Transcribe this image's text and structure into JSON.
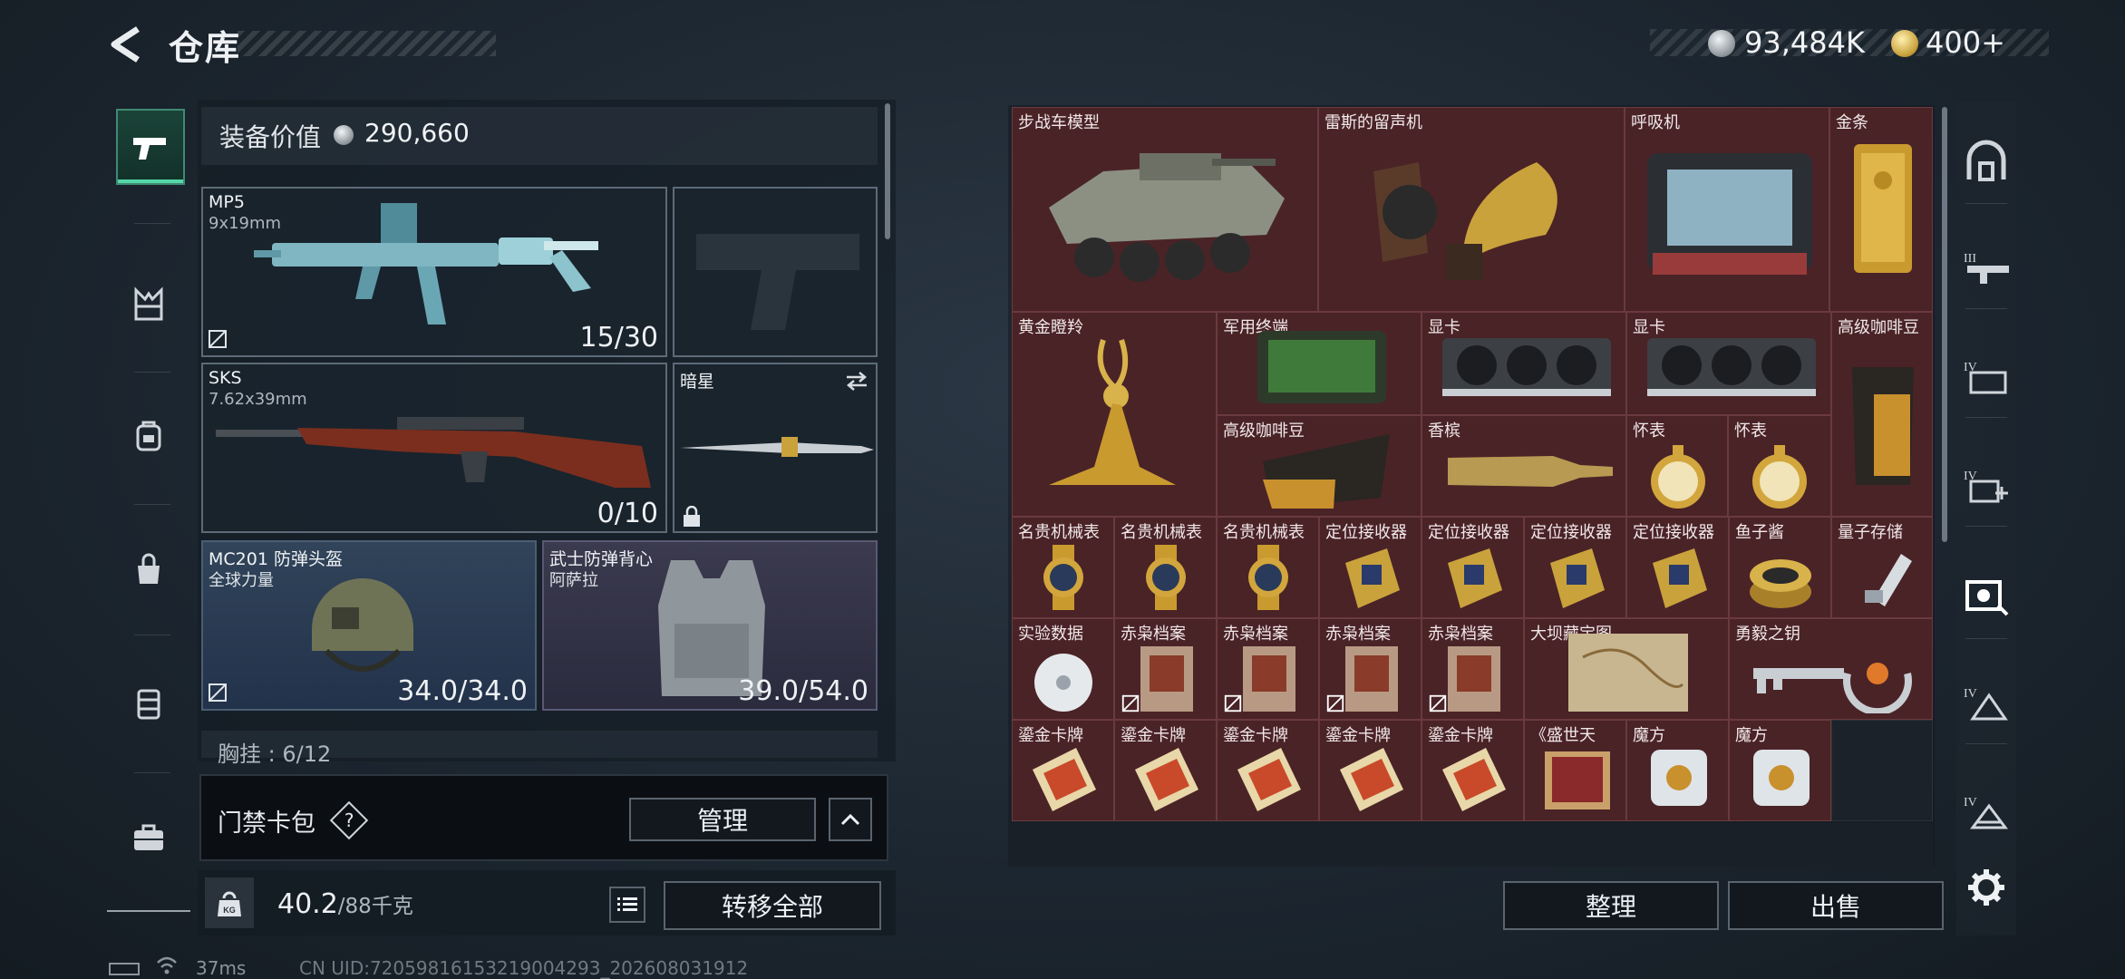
{
  "header": {
    "title": "仓库",
    "currency1": "93,484K",
    "currency2": "400+"
  },
  "loadout": {
    "equipment_value_label": "装备价值",
    "equipment_value": "290,660",
    "primary": {
      "name": "MP5",
      "ammo_type": "9x19mm",
      "ammo": "15/30"
    },
    "secondary": {
      "name": "SKS",
      "ammo_type": "7.62x39mm",
      "ammo": "0/10"
    },
    "melee": {
      "name": "暗星"
    },
    "helmet": {
      "name": "MC201 防弹头盔",
      "brand": "全球力量",
      "durability": "34.0/34.0"
    },
    "armor": {
      "name": "武士防弹背心",
      "brand": "阿萨拉",
      "durability": "39.0/54.0"
    },
    "chest_rig_partial": "胸挂 : 6/12"
  },
  "card_bag": {
    "label": "门禁卡包",
    "help": "?",
    "manage_label": "管理"
  },
  "weight": {
    "current": "40.2",
    "max": "/88千克",
    "kg_icon_label": "KG"
  },
  "transfer_all_label": "转移全部",
  "storage": {
    "items": [
      {
        "label": "步战车模型"
      },
      {
        "label": "雷斯的留声机"
      },
      {
        "label": "呼吸机"
      },
      {
        "label": "金条"
      },
      {
        "label": "黄金瞪羚"
      },
      {
        "label": "军用终端"
      },
      {
        "label": "显卡"
      },
      {
        "label": "显卡"
      },
      {
        "label": "高级咖啡豆"
      },
      {
        "label": "高级咖啡豆"
      },
      {
        "label": "香槟"
      },
      {
        "label": "怀表"
      },
      {
        "label": "怀表"
      },
      {
        "label": "名贵机械表"
      },
      {
        "label": "名贵机械表"
      },
      {
        "label": "名贵机械表"
      },
      {
        "label": "定位接收器"
      },
      {
        "label": "定位接收器"
      },
      {
        "label": "定位接收器"
      },
      {
        "label": "定位接收器"
      },
      {
        "label": "鱼子酱"
      },
      {
        "label": "量子存储"
      },
      {
        "label": "实验数据"
      },
      {
        "label": "赤枭档案"
      },
      {
        "label": "赤枭档案"
      },
      {
        "label": "赤枭档案"
      },
      {
        "label": "赤枭档案"
      },
      {
        "label": "大坝藏宝图"
      },
      {
        "label": "勇毅之钥"
      },
      {
        "label": "鎏金卡牌"
      },
      {
        "label": "鎏金卡牌"
      },
      {
        "label": "鎏金卡牌"
      },
      {
        "label": "鎏金卡牌"
      },
      {
        "label": "鎏金卡牌"
      },
      {
        "label": "《盛世天"
      },
      {
        "label": "魔方"
      },
      {
        "label": "魔方"
      }
    ],
    "sort_label": "整理",
    "sell_label": "出售"
  },
  "status": {
    "ping": "37ms",
    "uid": "CN UID:720598161532190042​93_202608031912"
  },
  "filters": [
    "all-icon",
    "weapon-lv3-icon",
    "equipment-lv4-icon",
    "medical-lv4-icon",
    "collectibles-icon",
    "resources-lv4-icon",
    "misc-lv4-icon"
  ],
  "colors": {
    "cell": "#4a2327",
    "accent_green": "#55d6a8",
    "bg": "#1d2731"
  }
}
